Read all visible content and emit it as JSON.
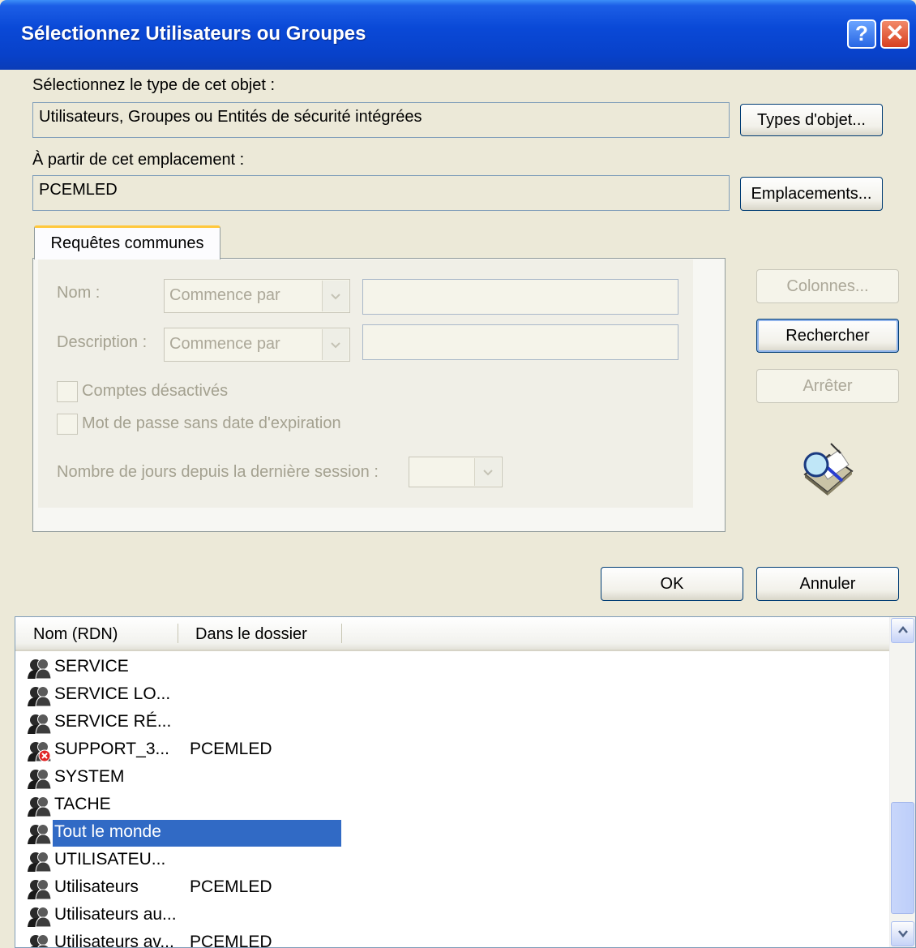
{
  "window": {
    "title": "Sélectionnez Utilisateurs ou Groupes",
    "help_glyph": "?",
    "close_glyph": "✕"
  },
  "object_type": {
    "label": "Sélectionnez le type de cet objet :",
    "value": "Utilisateurs, Groupes ou Entités de sécurité intégrées",
    "button": "Types d'objet..."
  },
  "location": {
    "label": "À partir de cet emplacement :",
    "value": "PCEMLED",
    "button": "Emplacements..."
  },
  "tab": {
    "label": "Requêtes communes",
    "name_label": "Nom :",
    "name_combo": "Commence par",
    "desc_label": "Description :",
    "desc_combo": "Commence par",
    "disabled_accounts": "Comptes désactivés",
    "no_expiry": "Mot de passe sans date d'expiration",
    "days_label": "Nombre de jours depuis la dernière session :"
  },
  "side_buttons": {
    "columns": "Colonnes...",
    "search": "Rechercher",
    "stop": "Arrêter"
  },
  "actions": {
    "ok": "OK",
    "cancel": "Annuler"
  },
  "results": {
    "columns": [
      "Nom (RDN)",
      "Dans le dossier"
    ],
    "rows": [
      {
        "name": "SERVICE",
        "folder": "",
        "disabled": false,
        "selected": false
      },
      {
        "name": "SERVICE LO...",
        "folder": "",
        "disabled": false,
        "selected": false
      },
      {
        "name": "SERVICE RÉ...",
        "folder": "",
        "disabled": false,
        "selected": false
      },
      {
        "name": "SUPPORT_3...",
        "folder": "PCEMLED",
        "disabled": true,
        "selected": false
      },
      {
        "name": "SYSTEM",
        "folder": "",
        "disabled": false,
        "selected": false
      },
      {
        "name": "TACHE",
        "folder": "",
        "disabled": false,
        "selected": false
      },
      {
        "name": "Tout le monde",
        "folder": "",
        "disabled": false,
        "selected": true
      },
      {
        "name": "UTILISATEU...",
        "folder": "",
        "disabled": false,
        "selected": false
      },
      {
        "name": "Utilisateurs",
        "folder": "PCEMLED",
        "disabled": false,
        "selected": false
      },
      {
        "name": "Utilisateurs au...",
        "folder": "",
        "disabled": false,
        "selected": false
      },
      {
        "name": "Utilisateurs av...",
        "folder": "PCEMLED",
        "disabled": false,
        "selected": false
      }
    ]
  }
}
